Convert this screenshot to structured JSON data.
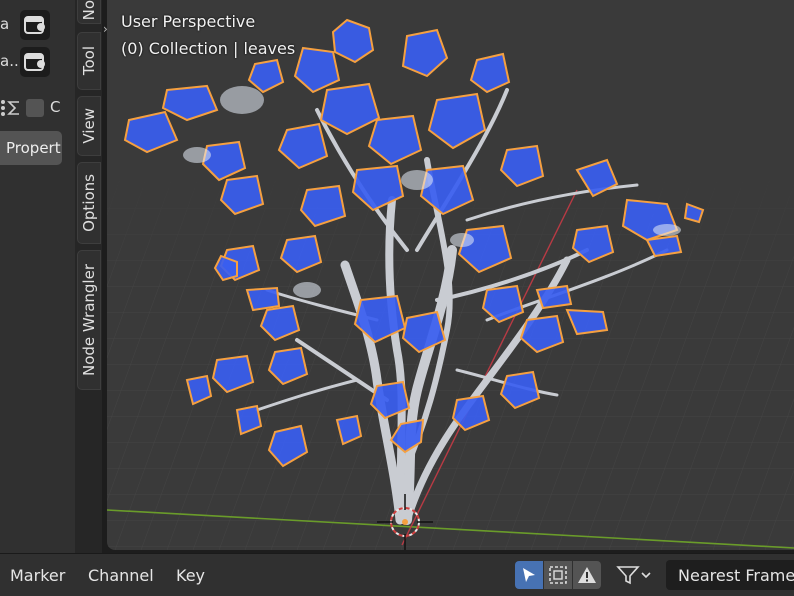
{
  "left_panel": {
    "row1_label": "a",
    "row2_label": "a...",
    "row3_label": "C",
    "properties_button": "Propert"
  },
  "tabs": [
    "No",
    "Tool",
    "View",
    "Options",
    "Node Wrangler"
  ],
  "viewport": {
    "perspective_label": "User Perspective",
    "collection_label": "(0) Collection | leaves"
  },
  "bottom_bar": {
    "menus": [
      "Marker",
      "Channel",
      "Key"
    ],
    "snap_value": "Nearest Frame"
  },
  "colors": {
    "selection_outline": "#f5a040",
    "leaf_blue": "#3a5ef0",
    "accent": "#4772b3",
    "x_axis": "#b83a44",
    "y_axis": "#6a9c2a"
  },
  "icons": [
    "node-icon",
    "sigma-icon",
    "checkbox-icon",
    "select-arrow-icon",
    "box-select-icon",
    "warning-icon",
    "filter-icon",
    "chevron-down-icon",
    "origin-cursor-icon"
  ]
}
